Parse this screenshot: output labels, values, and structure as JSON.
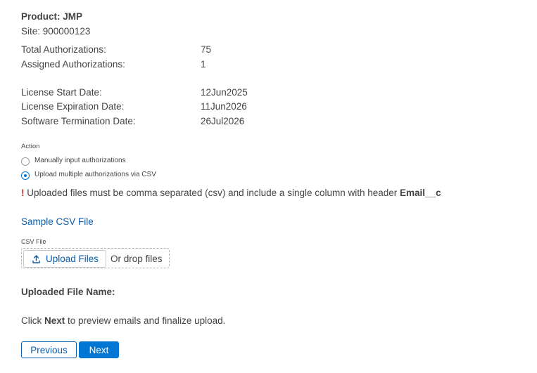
{
  "product": {
    "label": "Product: JMP"
  },
  "site": {
    "label": "Site: 900000123"
  },
  "authorizations": {
    "total_label": "Total Authorizations:",
    "total_value": "75",
    "assigned_label": "Assigned Authorizations:",
    "assigned_value": "1"
  },
  "dates": {
    "start_label": "License Start Date:",
    "start_value": "12Jun2025",
    "expiration_label": "License Expiration Date:",
    "expiration_value": "11Jun2026",
    "termination_label": "Software Termination Date:",
    "termination_value": "26Jul2026"
  },
  "action": {
    "heading": "Action",
    "options": [
      {
        "label": "Manually input authorizations",
        "selected": false
      },
      {
        "label": "Upload multiple authorizations via CSV",
        "selected": true
      }
    ]
  },
  "warning": {
    "mark": "!",
    "text": " Uploaded files must be comma separated (csv) and include a single column with header ",
    "field": "Email__c"
  },
  "sample_link": "Sample CSV File",
  "csv": {
    "label": "CSV File",
    "upload_button": "Upload Files",
    "upload_icon": "upload-arrow-icon",
    "drop_text": "Or drop files"
  },
  "uploaded_file_label": "Uploaded File Name:",
  "instruction": {
    "prefix": "Click ",
    "keyword": "Next",
    "suffix": " to preview emails and finalize upload."
  },
  "buttons": {
    "previous": "Previous",
    "next": "Next"
  },
  "colors": {
    "accent": "#0176d3",
    "link": "#0b5cab",
    "warning": "#c23934",
    "text": "#444444"
  }
}
